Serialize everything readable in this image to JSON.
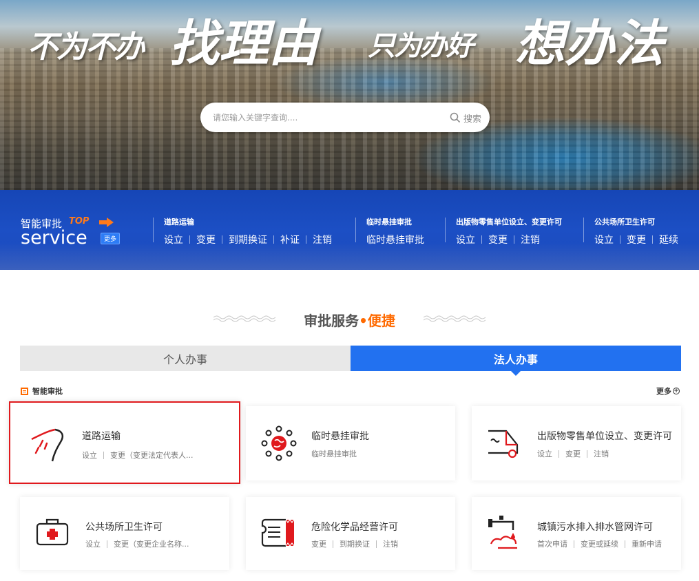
{
  "hero": {
    "slogan_small_1": "不为不办",
    "slogan_big_1": "找理由",
    "slogan_small_2": "只为办好",
    "slogan_big_2": "想办法"
  },
  "search": {
    "placeholder": "请您输入关键字查询....",
    "button_label": "搜索",
    "icon": "search-icon"
  },
  "service_bar": {
    "logo_cn": "智能审批",
    "logo_top": "TOP",
    "logo_en": "service",
    "more_label": "更多",
    "groups": [
      {
        "title": "道路运输",
        "links": [
          "设立",
          "变更",
          "到期换证",
          "补证",
          "注销"
        ]
      },
      {
        "title": "临时悬挂审批",
        "links": [
          "临时悬挂审批"
        ]
      },
      {
        "title": "出版物零售单位设立、变更许可",
        "links": [
          "设立",
          "变更",
          "注销"
        ]
      },
      {
        "title": "公共场所卫生许可",
        "links": [
          "设立",
          "变更",
          "延续"
        ]
      }
    ]
  },
  "section": {
    "title_main": "审批服务",
    "title_dot": "•",
    "title_accent": "便捷"
  },
  "tabs": {
    "personal": "个人办事",
    "legal": "法人办事",
    "active": "legal"
  },
  "subhead": {
    "label": "智能审批",
    "more": "更多"
  },
  "cards": [
    {
      "name": "道路运输",
      "icon": "road-icon",
      "subs": [
        "设立",
        "变更（变更法定代表人..."
      ],
      "active": true
    },
    {
      "name": "临时悬挂审批",
      "icon": "globe-network-icon",
      "subs": [
        "临时悬挂审批"
      ],
      "active": false
    },
    {
      "name": "出版物零售单位设立、变更许可",
      "icon": "delivery-truck-icon",
      "subs": [
        "设立",
        "变更",
        "注销"
      ],
      "active": false
    },
    {
      "name": "公共场所卫生许可",
      "icon": "first-aid-kit-icon",
      "subs": [
        "设立",
        "变更（变更企业名称..."
      ],
      "active": false
    },
    {
      "name": "危险化学品经营许可",
      "icon": "hazard-document-icon",
      "subs": [
        "变更",
        "到期换证",
        "注销"
      ],
      "active": false
    },
    {
      "name": "城镇污水排入排水管网许可",
      "icon": "sewage-pipe-icon",
      "subs": [
        "首次申请",
        "变更或延续",
        "重新申请"
      ],
      "active": false
    }
  ],
  "colors": {
    "brand_blue": "#2271f0",
    "service_bar_blue": "#1c4fc4",
    "accent_orange": "#ff6a00",
    "active_border_red": "#e0191d",
    "icon_red": "#e0191d"
  }
}
